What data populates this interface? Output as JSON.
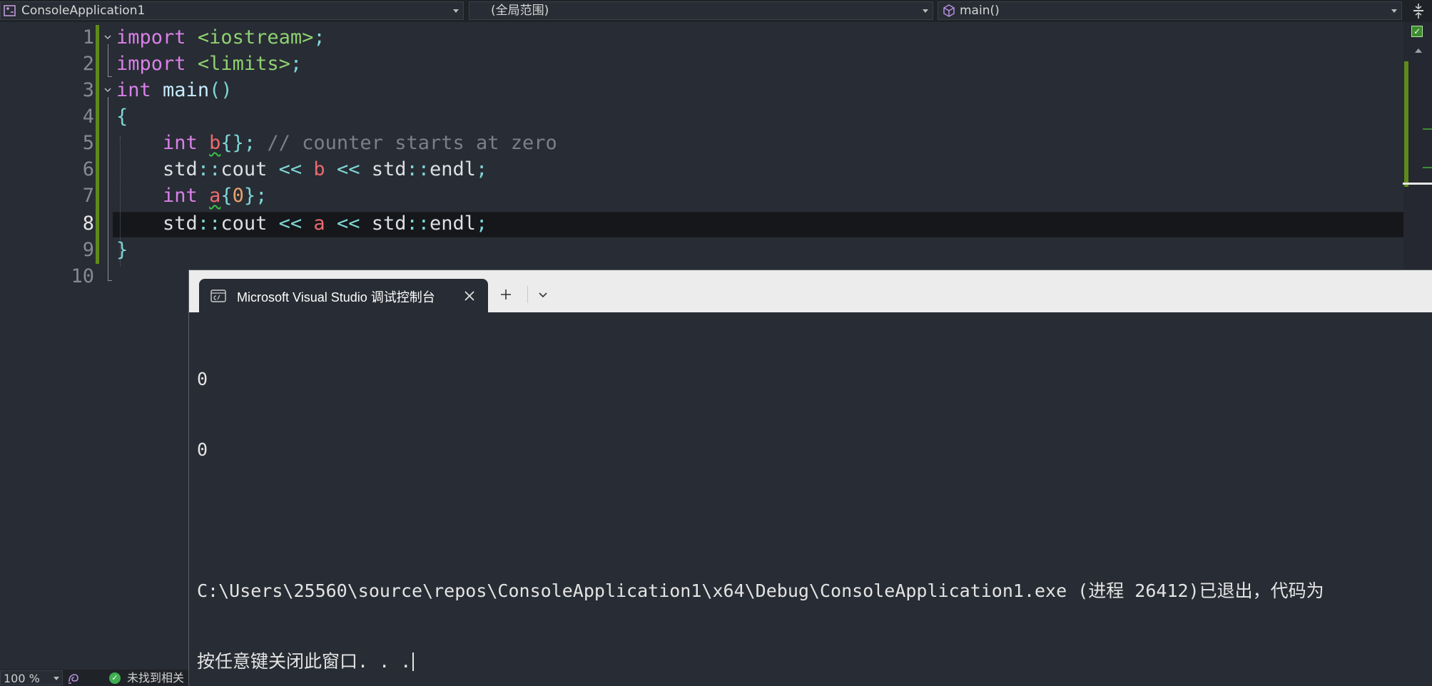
{
  "nav": {
    "project": "ConsoleApplication1",
    "scope": "(全局范围)",
    "member": "main()"
  },
  "editor": {
    "line_numbers": [
      "1",
      "2",
      "3",
      "4",
      "5",
      "6",
      "7",
      "8",
      "9",
      "10"
    ],
    "current_line": "8",
    "lines": {
      "l1": {
        "kw": "import",
        "hdr": "<iostream>",
        "semi": ";"
      },
      "l2": {
        "kw": "import",
        "hdr": "<limits>",
        "semi": ";"
      },
      "l3": {
        "kw": "int",
        "fn": "main",
        "parens": "()"
      },
      "l4": {
        "brace": "{"
      },
      "l5": {
        "kw": "int",
        "var": "b",
        "init": "{}",
        "semi": ";",
        "comment": "// counter starts at zero"
      },
      "l6": {
        "std1": "std",
        "sep1": "::",
        "cout": "cout",
        "op1": "<<",
        "var": "b",
        "op2": "<<",
        "std2": "std",
        "sep2": "::",
        "endl": "endl",
        "semi": ";"
      },
      "l7": {
        "kw": "int",
        "var": "a",
        "open": "{",
        "num": "0",
        "close": "}",
        "semi": ";"
      },
      "l8": {
        "std1": "std",
        "sep1": "::",
        "cout": "cout",
        "op1": "<<",
        "var": "a",
        "op2": "<<",
        "std2": "std",
        "sep2": "::",
        "endl": "endl",
        "semi": ";"
      },
      "l9": {
        "brace": "}"
      }
    }
  },
  "statusbar": {
    "zoom": "100 %",
    "issues": "未找到相关"
  },
  "console": {
    "tab_title": "Microsoft Visual Studio 调试控制台",
    "output": [
      "0",
      "0",
      "",
      "C:\\Users\\25560\\source\\repos\\ConsoleApplication1\\x64\\Debug\\ConsoleApplication1.exe (进程 26412)已退出，代码为",
      "按任意键关闭此窗口. . ."
    ]
  },
  "colors": {
    "editor_bg": "#282c34",
    "keyword": "#d980e8",
    "header_string": "#8fd170",
    "variable": "#ec6a6f",
    "number": "#e7a36b",
    "comment": "#7b8088",
    "change_bar": "#5f8a1b"
  }
}
